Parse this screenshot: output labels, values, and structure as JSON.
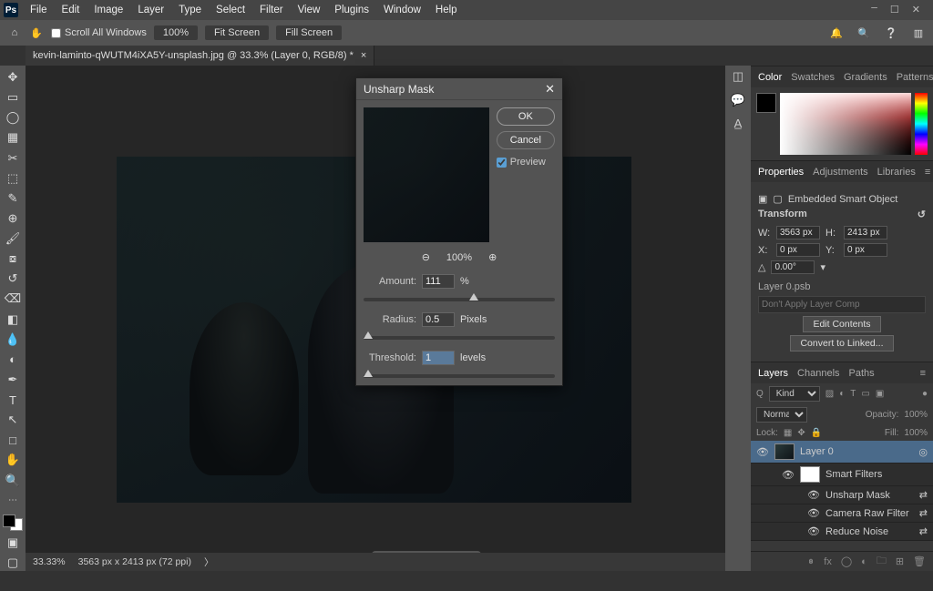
{
  "menubar": {
    "items": [
      "File",
      "Edit",
      "Image",
      "Layer",
      "Type",
      "Select",
      "Filter",
      "View",
      "Plugins",
      "Window",
      "Help"
    ]
  },
  "optbar": {
    "scroll_all_label": "Scroll All Windows",
    "zoom_field": "100%",
    "btn_fit": "Fit Screen",
    "btn_fill": "Fill Screen"
  },
  "document": {
    "tab_title": "kevin-laminto-qWUTM4iXA5Y-unsplash.jpg @ 33.3% (Layer 0, RGB/8) *",
    "status_zoom": "33.33%",
    "status_dims": "3563 px x 2413 px (72 ppi)"
  },
  "panels": {
    "color_tabs": [
      "Color",
      "Swatches",
      "Gradients",
      "Patterns"
    ],
    "props_tabs": [
      "Properties",
      "Adjustments",
      "Libraries"
    ],
    "layers_tabs": [
      "Layers",
      "Channels",
      "Paths"
    ]
  },
  "properties": {
    "kind_label": "Embedded Smart Object",
    "section_transform": "Transform",
    "w_label": "W:",
    "w_value": "3563 px",
    "h_label": "H:",
    "h_value": "2413 px",
    "x_label": "X:",
    "x_value": "0 px",
    "y_label": "Y:",
    "y_value": "0 px",
    "angle_value": "0.00°",
    "psb_name": "Layer 0.psb",
    "layer_comp_placeholder": "Don't Apply Layer Comp",
    "btn_edit": "Edit Contents",
    "btn_convert": "Convert to Linked..."
  },
  "layers": {
    "kind_label": "Kind",
    "blend_mode": "Normal",
    "opacity_label": "Opacity:",
    "opacity_value": "100%",
    "lock_label": "Lock:",
    "fill_label": "Fill:",
    "fill_value": "100%",
    "items": [
      {
        "name": "Layer 0"
      },
      {
        "name": "Smart Filters"
      },
      {
        "name": "Unsharp Mask"
      },
      {
        "name": "Camera Raw Filter"
      },
      {
        "name": "Reduce Noise"
      }
    ]
  },
  "dialog": {
    "title": "Unsharp Mask",
    "btn_ok": "OK",
    "btn_cancel": "Cancel",
    "chk_preview": "Preview",
    "zoom": "100%",
    "amount_label": "Amount:",
    "amount_value": "111",
    "amount_unit": "%",
    "radius_label": "Radius:",
    "radius_value": "0.5",
    "radius_unit": "Pixels",
    "threshold_label": "Threshold:",
    "threshold_value": "1",
    "threshold_unit": "levels"
  }
}
